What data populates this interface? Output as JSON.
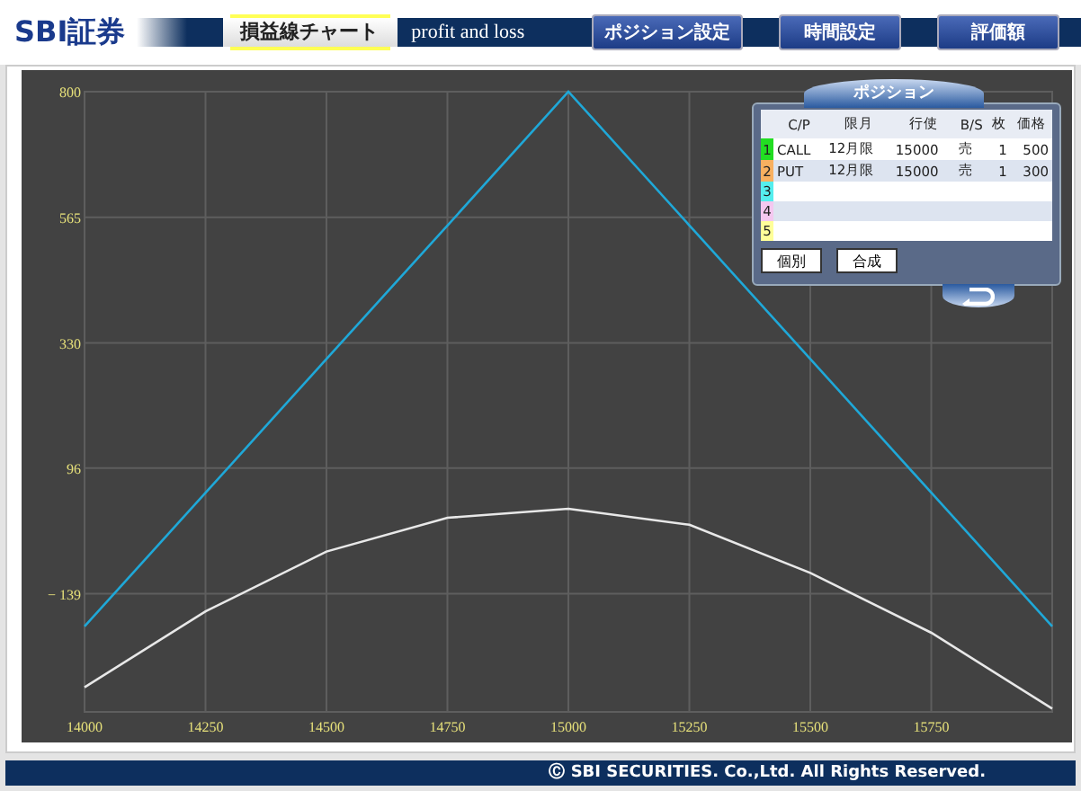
{
  "header": {
    "logo": "SBI証券",
    "tab": {
      "label": "損益線チャート",
      "selected": true
    },
    "subtitle": "profit and loss",
    "buttons": [
      "ポジション設定",
      "時間設定",
      "評価額"
    ]
  },
  "chart": {
    "chart_data": {
      "type": "line",
      "x": [
        14000,
        14250,
        14500,
        14750,
        15000,
        15250,
        15500,
        15750,
        16000
      ],
      "series": [
        {
          "color": "#1fa8d8",
          "values": [
            -200,
            50,
            300,
            550,
            800,
            550,
            300,
            50,
            -200
          ]
        },
        {
          "color": "#e8e8e8",
          "values": [
            -314,
            -172,
            -60,
            3,
            20,
            -10,
            -100,
            -212,
            -354
          ]
        }
      ],
      "grid": true,
      "xlim": [
        14000,
        16000
      ],
      "ylim": [
        -360,
        800
      ],
      "xticks": [
        14000,
        14250,
        14500,
        14750,
        15000,
        15250,
        15500,
        15750
      ],
      "yticks": [
        800,
        565,
        330,
        96,
        -139
      ]
    }
  },
  "positions": {
    "title": "ポジション",
    "columns": [
      "C/P",
      "限月",
      "行使",
      "B/S",
      "枚",
      "価格"
    ],
    "rows": [
      {
        "number": "1",
        "color": "#22dd22",
        "cells": [
          "CALL",
          "12月限",
          "15000",
          "売",
          "1",
          "500"
        ]
      },
      {
        "number": "2",
        "color": "#f8b060",
        "cells": [
          "PUT",
          "12月限",
          "15000",
          "売",
          "1",
          "300"
        ]
      },
      {
        "number": "3",
        "color": "#55eeee",
        "cells": []
      },
      {
        "number": "4",
        "color": "#f4c8f0",
        "cells": []
      },
      {
        "number": "5",
        "color": "#ffff99",
        "cells": []
      }
    ],
    "buttons": [
      "個別",
      "合成"
    ]
  },
  "footer": {
    "copyright": "Ⓒ SBI SECURITIES. Co.,Ltd. All Rights Reserved."
  }
}
